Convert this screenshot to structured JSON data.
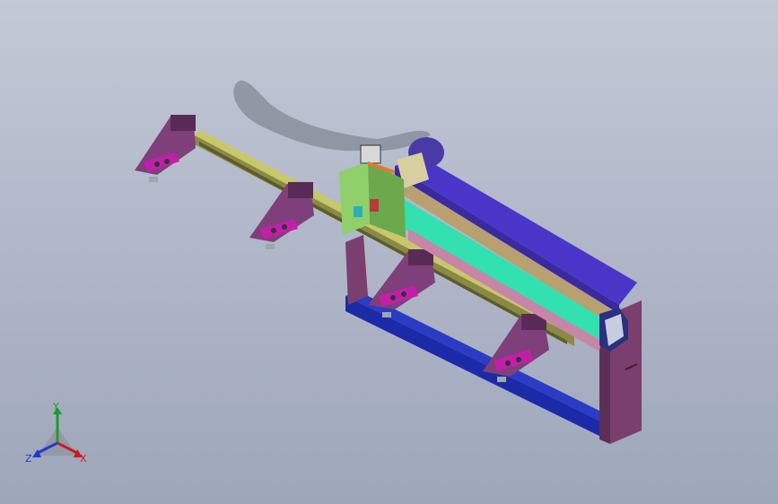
{
  "viewport": {
    "background_top": "#c3c9d6",
    "background_bottom": "#9ea6ba"
  },
  "model": {
    "colors": {
      "bracket": "#7e3f7a",
      "bracket_dark": "#5a2a57",
      "magenta_pad": "#c21fa8",
      "rail_yellow": "#c8c86a",
      "rail_dark": "#8a8a45",
      "cover_cyan": "#33e0b0",
      "cover_purple": "#4b35c9",
      "base_blue": "#1d2aa8",
      "frame_purple": "#7a3f6e",
      "carriage_green": "#8fd06a",
      "motor_purple": "#4a3aa8",
      "motor_beige": "#d8cfa0"
    }
  },
  "triad": {
    "x_label": "X",
    "y_label": "Y",
    "z_label": "Z",
    "x_color": "#c81e1e",
    "y_color": "#1a9e2a",
    "z_color": "#1e3cc8"
  }
}
